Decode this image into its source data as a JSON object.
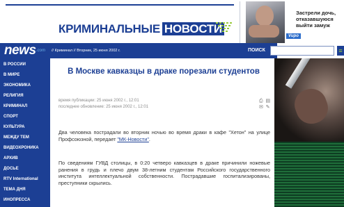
{
  "header": {
    "logo_part1": "КРИМИНАЛЬНЫЕ",
    "logo_part2": "НОВОСТИ"
  },
  "ad": {
    "lines": [
      "Застрели дочь,",
      "отказавшуюся",
      "выйти замуж"
    ],
    "logo": "Vupo"
  },
  "bar": {
    "brand": "news",
    "brand_suffix": ".com",
    "date": "// Криминал // Вторник, 25 июня 2002 г.",
    "search_label": "ПОИСК",
    "search_go": "≡"
  },
  "sidebar": {
    "items": [
      "В РОССИИ",
      "В МИРЕ",
      "ЭКОНОМИКА",
      "РЕЛИГИЯ",
      "КРИМИНАЛ",
      "СПОРТ",
      "КУЛЬТУРА",
      "МЕЖДУ ТЕМ",
      "ВИДЕОХРОНИКА",
      "АРХИВ",
      "ДОСЬЕ",
      "RTV International",
      "ТЕМА ДНЯ",
      "ИНОПРЕССА"
    ]
  },
  "article": {
    "title": "В Москве кавказцы в драке порезали студентов",
    "published": "время публикации: 25 июня 2002 г., 12:01",
    "updated": "последнее обновление: 25 июня 2002 г., 12:01",
    "tools": "⎙ ▤ ✉ ✎",
    "para1_text": "Два человека пострадали во вторник ночью во время драки в кафе \"Хетон\" на улице Профсоюзной, передает ",
    "para1_link": "\"МК-Новости\"",
    "para1_end": ".",
    "para2": "По сведениям ГУВД столицы, в 0:20 четверо кавказцев в драке причинили ножевые ранения в грудь и плечо двум 38-летним студентам Российского государственного института интеллектуальной собственности. Пострадавшие госпитализированы, преступники скрылись."
  }
}
